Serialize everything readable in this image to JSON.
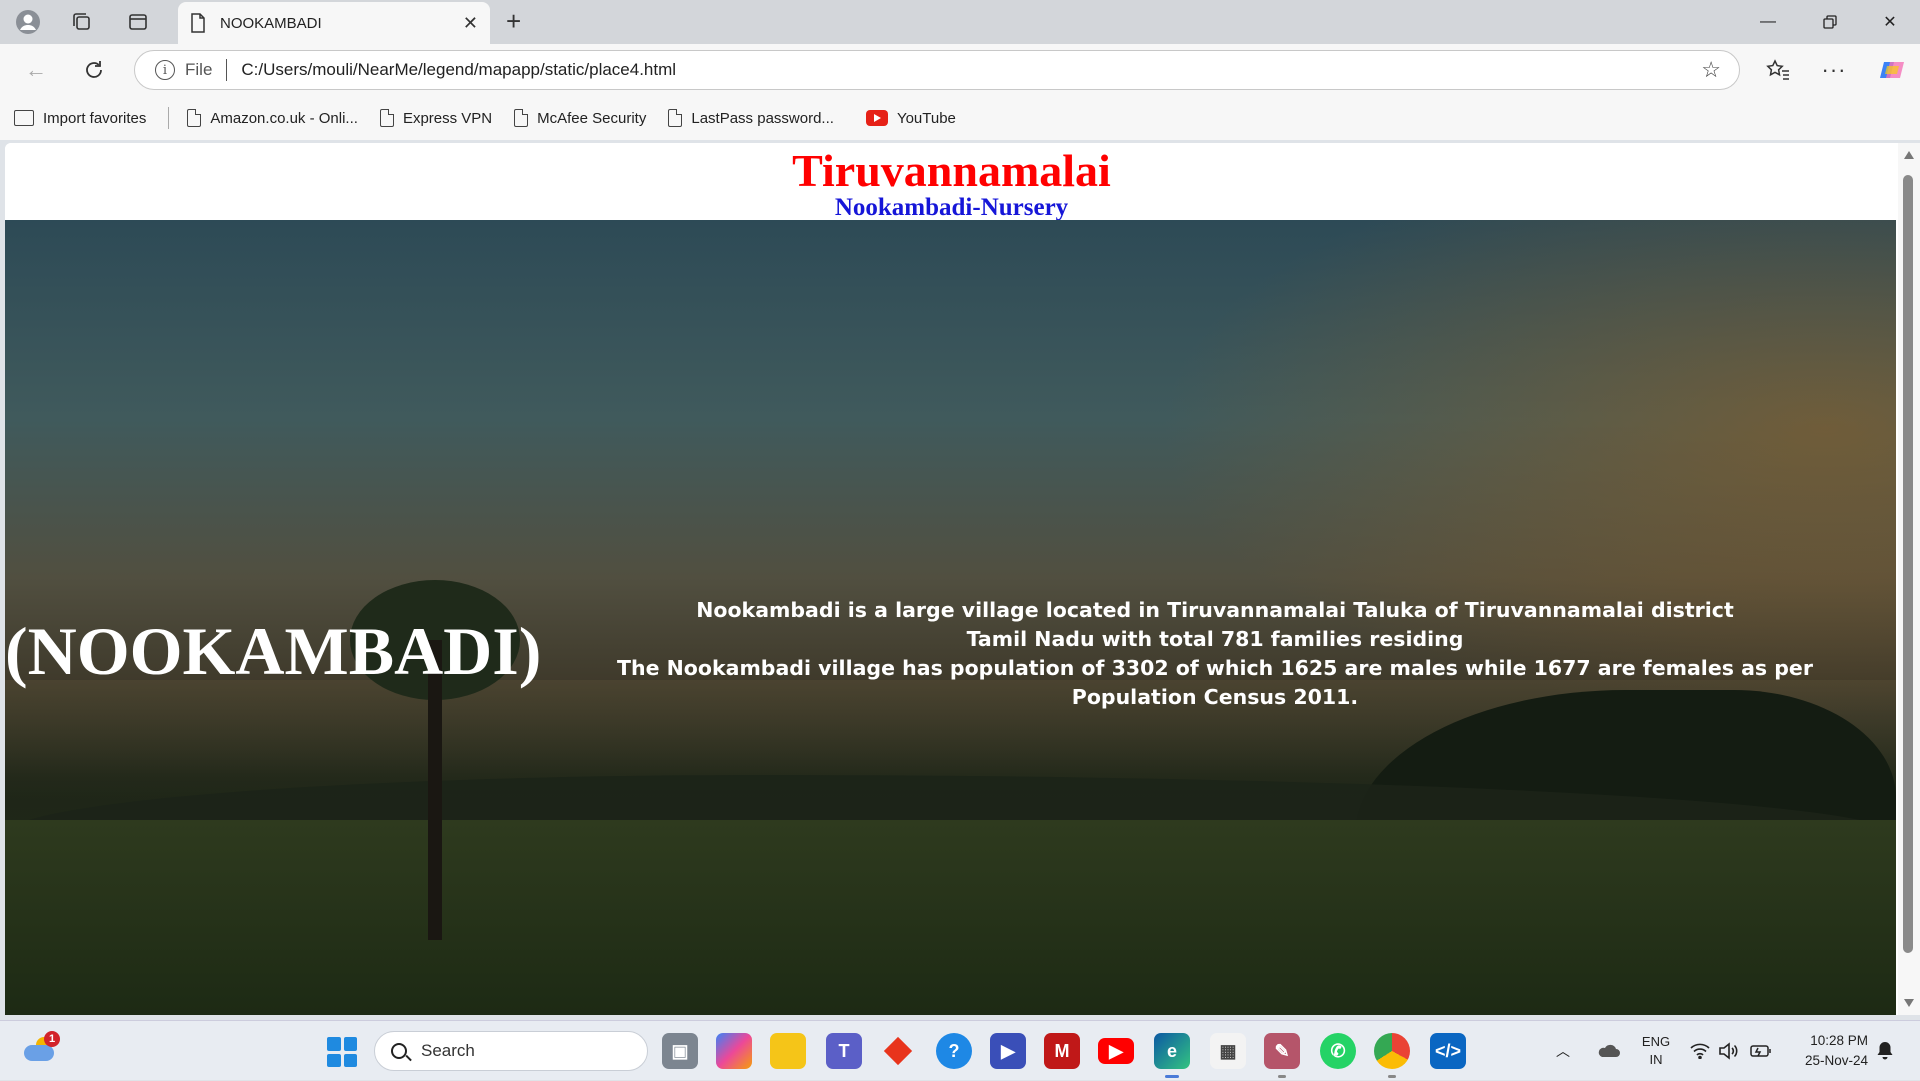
{
  "browser": {
    "tab": {
      "title": "NOOKAMBADI"
    },
    "address": {
      "scheme": "File",
      "url": "C:/Users/mouli/NearMe/legend/mapapp/static/place4.html"
    },
    "bookmarks": [
      {
        "label": "Import favorites"
      },
      {
        "label": "Amazon.co.uk - Onli..."
      },
      {
        "label": "Express VPN"
      },
      {
        "label": "McAfee Security"
      },
      {
        "label": "LastPass password..."
      },
      {
        "label": "YouTube"
      }
    ]
  },
  "page": {
    "title": "Tiruvannamalai",
    "subtitle": "Nookambadi-Nursery",
    "hero_label": "(NOOKAMBADI)",
    "description": [
      "Nookambadi is a large village located in Tiruvannamalai Taluka of Tiruvannamalai district",
      "Tamil Nadu with total 781 families residing",
      "The Nookambadi village has population of 3302 of which 1625 are males while 1677 are females as per Population Census 2011."
    ]
  },
  "taskbar": {
    "weather_badge": "1",
    "search_placeholder": "Search",
    "apps": [
      {
        "icon": "task-view-icon"
      },
      {
        "icon": "copilot-icon"
      },
      {
        "icon": "file-explorer-icon"
      },
      {
        "icon": "teams-icon"
      },
      {
        "icon": "git-icon"
      },
      {
        "icon": "get-help-icon"
      },
      {
        "icon": "media-player-icon"
      },
      {
        "icon": "mcafee-icon"
      },
      {
        "icon": "youtube-icon"
      },
      {
        "icon": "edge-icon"
      },
      {
        "icon": "microsoft-store-icon"
      },
      {
        "icon": "paint-icon"
      },
      {
        "icon": "whatsapp-icon"
      },
      {
        "icon": "chrome-icon"
      },
      {
        "icon": "vscode-icon"
      }
    ],
    "language": [
      "ENG",
      "IN"
    ],
    "time": "10:28 PM",
    "date": "25-Nov-24"
  }
}
